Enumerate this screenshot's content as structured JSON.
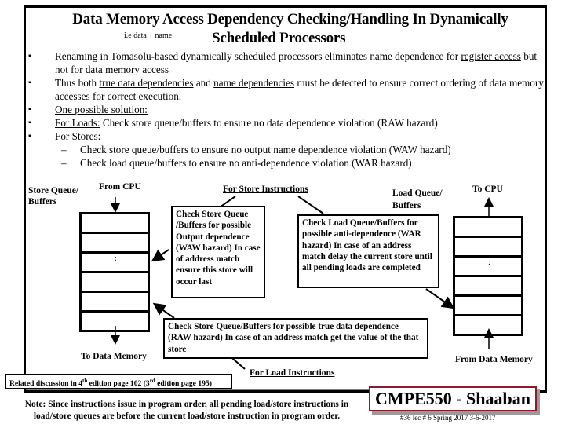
{
  "slide": {
    "title_line1": "Data Memory Access Dependency Checking/Handling In Dynamically",
    "title_line2": "Scheduled Processors",
    "title_annotation": "i.e data + name"
  },
  "bullets": [
    {
      "marker": "▪",
      "parts": [
        {
          "text": "Renaming in Tomasolu-based dynamically scheduled processors eliminates name dependence for ",
          "u": false
        },
        {
          "text": "register access",
          "u": true
        },
        {
          "text": " but not for data memory access",
          "u": false
        }
      ]
    },
    {
      "marker": "▪",
      "parts": [
        {
          "text": "Thus both ",
          "u": false
        },
        {
          "text": "true data dependencies",
          "u": true
        },
        {
          "text": "  and  ",
          "u": false
        },
        {
          "text": "name dependencies",
          "u": true
        },
        {
          "text": " must be detected to ensure correct ordering of data memory accesses for correct execution.",
          "u": false
        }
      ]
    },
    {
      "marker": "▪",
      "parts": [
        {
          "text": "One possible solution:",
          "u": true
        }
      ]
    },
    {
      "marker": "▪",
      "parts": [
        {
          "text": "For Loads:",
          "u": true
        },
        {
          "text": "   Check store queue/buffers to ensure no data dependence violation (RAW hazard)",
          "u": false
        }
      ]
    },
    {
      "marker": "▪",
      "parts": [
        {
          "text": "For Stores:",
          "u": true
        }
      ]
    }
  ],
  "sub_bullets": [
    {
      "marker": "–",
      "text": "Check store queue/buffers to ensure no output name dependence violation (WAW hazard)"
    },
    {
      "marker": "–",
      "text": "Check load queue/buffers to ensure no anti-dependence violation (WAR hazard)"
    }
  ],
  "diagram": {
    "store_queue_label": "Store Queue/ Buffers",
    "from_cpu": "From CPU",
    "to_data_memory": "To Data Memory",
    "load_queue_label": "Load Queue/ Buffers",
    "to_cpu": "To CPU",
    "from_data_memory": "From Data Memory",
    "for_store_instructions": "For Store Instructions",
    "for_load_instructions": "For Load Instructions",
    "store_waw_note": "Check Store Queue /Buffers for possible Output dependence (WAW hazard) In case of address match ensure this store will occur last",
    "load_war_note": "Check Load Queue/Buffers for possible anti-dependence (WAR hazard) In case of an address match delay the current store until all pending loads are completed",
    "raw_note": "Check Store Queue/Buffers for possible true data dependence (RAW hazard) In case of an address match get the value of the that store",
    "ellipsis": ":",
    "queue_slots": 6
  },
  "related_discussion": {
    "prefix": "Related discussion in 4",
    "sup1": "th",
    "middle": " edition page 102 (3",
    "sup2": "rd",
    "suffix": " edition page 195)"
  },
  "footnote": "Note: Since instructions issue in program order,  all pending load/store instructions in load/store queues are before the current load/store instruction in program order.",
  "footer": {
    "brand": "CMPE550 - Shaaban",
    "lecture_info": "#36   lec # 6  Spring 2017  3-6-2017",
    "brand_border_color": "#8b1a2b",
    "shadow_color": "#9a9a9a"
  }
}
